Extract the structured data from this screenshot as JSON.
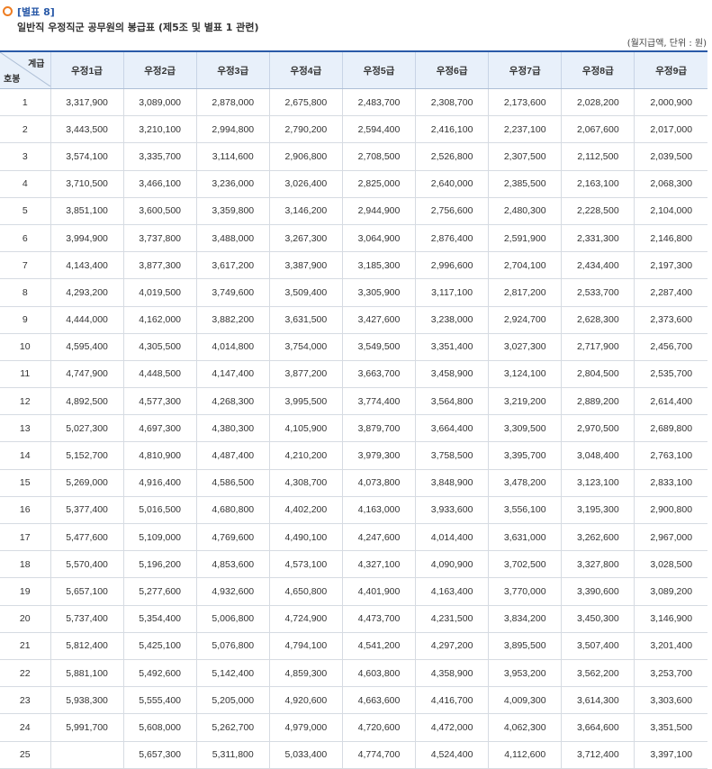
{
  "header": {
    "label": "[별표 8]",
    "title": "일반직 우정직군 공무원의 봉급표 (제5조 및 별표 1 관련)",
    "unit": "(월지급액, 단위 : 원)"
  },
  "table": {
    "corner_top": "계급",
    "corner_bottom": "호봉",
    "columns": [
      "우정1급",
      "우정2급",
      "우정3급",
      "우정4급",
      "우정5급",
      "우정6급",
      "우정7급",
      "우정8급",
      "우정9급"
    ],
    "rows": [
      [
        "1",
        "3,317,900",
        "3,089,000",
        "2,878,000",
        "2,675,800",
        "2,483,700",
        "2,308,700",
        "2,173,600",
        "2,028,200",
        "2,000,900"
      ],
      [
        "2",
        "3,443,500",
        "3,210,100",
        "2,994,800",
        "2,790,200",
        "2,594,400",
        "2,416,100",
        "2,237,100",
        "2,067,600",
        "2,017,000"
      ],
      [
        "3",
        "3,574,100",
        "3,335,700",
        "3,114,600",
        "2,906,800",
        "2,708,500",
        "2,526,800",
        "2,307,500",
        "2,112,500",
        "2,039,500"
      ],
      [
        "4",
        "3,710,500",
        "3,466,100",
        "3,236,000",
        "3,026,400",
        "2,825,000",
        "2,640,000",
        "2,385,500",
        "2,163,100",
        "2,068,300"
      ],
      [
        "5",
        "3,851,100",
        "3,600,500",
        "3,359,800",
        "3,146,200",
        "2,944,900",
        "2,756,600",
        "2,480,300",
        "2,228,500",
        "2,104,000"
      ],
      [
        "6",
        "3,994,900",
        "3,737,800",
        "3,488,000",
        "3,267,300",
        "3,064,900",
        "2,876,400",
        "2,591,900",
        "2,331,300",
        "2,146,800"
      ],
      [
        "7",
        "4,143,400",
        "3,877,300",
        "3,617,200",
        "3,387,900",
        "3,185,300",
        "2,996,600",
        "2,704,100",
        "2,434,400",
        "2,197,300"
      ],
      [
        "8",
        "4,293,200",
        "4,019,500",
        "3,749,600",
        "3,509,400",
        "3,305,900",
        "3,117,100",
        "2,817,200",
        "2,533,700",
        "2,287,400"
      ],
      [
        "9",
        "4,444,000",
        "4,162,000",
        "3,882,200",
        "3,631,500",
        "3,427,600",
        "3,238,000",
        "2,924,700",
        "2,628,300",
        "2,373,600"
      ],
      [
        "10",
        "4,595,400",
        "4,305,500",
        "4,014,800",
        "3,754,000",
        "3,549,500",
        "3,351,400",
        "3,027,300",
        "2,717,900",
        "2,456,700"
      ],
      [
        "11",
        "4,747,900",
        "4,448,500",
        "4,147,400",
        "3,877,200",
        "3,663,700",
        "3,458,900",
        "3,124,100",
        "2,804,500",
        "2,535,700"
      ],
      [
        "12",
        "4,892,500",
        "4,577,300",
        "4,268,300",
        "3,995,500",
        "3,774,400",
        "3,564,800",
        "3,219,200",
        "2,889,200",
        "2,614,400"
      ],
      [
        "13",
        "5,027,300",
        "4,697,300",
        "4,380,300",
        "4,105,900",
        "3,879,700",
        "3,664,400",
        "3,309,500",
        "2,970,500",
        "2,689,800"
      ],
      [
        "14",
        "5,152,700",
        "4,810,900",
        "4,487,400",
        "4,210,200",
        "3,979,300",
        "3,758,500",
        "3,395,700",
        "3,048,400",
        "2,763,100"
      ],
      [
        "15",
        "5,269,000",
        "4,916,400",
        "4,586,500",
        "4,308,700",
        "4,073,800",
        "3,848,900",
        "3,478,200",
        "3,123,100",
        "2,833,100"
      ],
      [
        "16",
        "5,377,400",
        "5,016,500",
        "4,680,800",
        "4,402,200",
        "4,163,000",
        "3,933,600",
        "3,556,100",
        "3,195,300",
        "2,900,800"
      ],
      [
        "17",
        "5,477,600",
        "5,109,000",
        "4,769,600",
        "4,490,100",
        "4,247,600",
        "4,014,400",
        "3,631,000",
        "3,262,600",
        "2,967,000"
      ],
      [
        "18",
        "5,570,400",
        "5,196,200",
        "4,853,600",
        "4,573,100",
        "4,327,100",
        "4,090,900",
        "3,702,500",
        "3,327,800",
        "3,028,500"
      ],
      [
        "19",
        "5,657,100",
        "5,277,600",
        "4,932,600",
        "4,650,800",
        "4,401,900",
        "4,163,400",
        "3,770,000",
        "3,390,600",
        "3,089,200"
      ],
      [
        "20",
        "5,737,400",
        "5,354,400",
        "5,006,800",
        "4,724,900",
        "4,473,700",
        "4,231,500",
        "3,834,200",
        "3,450,300",
        "3,146,900"
      ],
      [
        "21",
        "5,812,400",
        "5,425,100",
        "5,076,800",
        "4,794,100",
        "4,541,200",
        "4,297,200",
        "3,895,500",
        "3,507,400",
        "3,201,400"
      ],
      [
        "22",
        "5,881,100",
        "5,492,600",
        "5,142,400",
        "4,859,300",
        "4,603,800",
        "4,358,900",
        "3,953,200",
        "3,562,200",
        "3,253,700"
      ],
      [
        "23",
        "5,938,300",
        "5,555,400",
        "5,205,000",
        "4,920,600",
        "4,663,600",
        "4,416,700",
        "4,009,300",
        "3,614,300",
        "3,303,600"
      ],
      [
        "24",
        "5,991,700",
        "5,608,000",
        "5,262,700",
        "4,979,000",
        "4,720,600",
        "4,472,000",
        "4,062,300",
        "3,664,600",
        "3,351,500"
      ],
      [
        "25",
        "",
        "5,657,300",
        "5,311,800",
        "5,033,400",
        "4,774,700",
        "4,524,400",
        "4,112,600",
        "3,712,400",
        "3,397,100"
      ]
    ]
  }
}
